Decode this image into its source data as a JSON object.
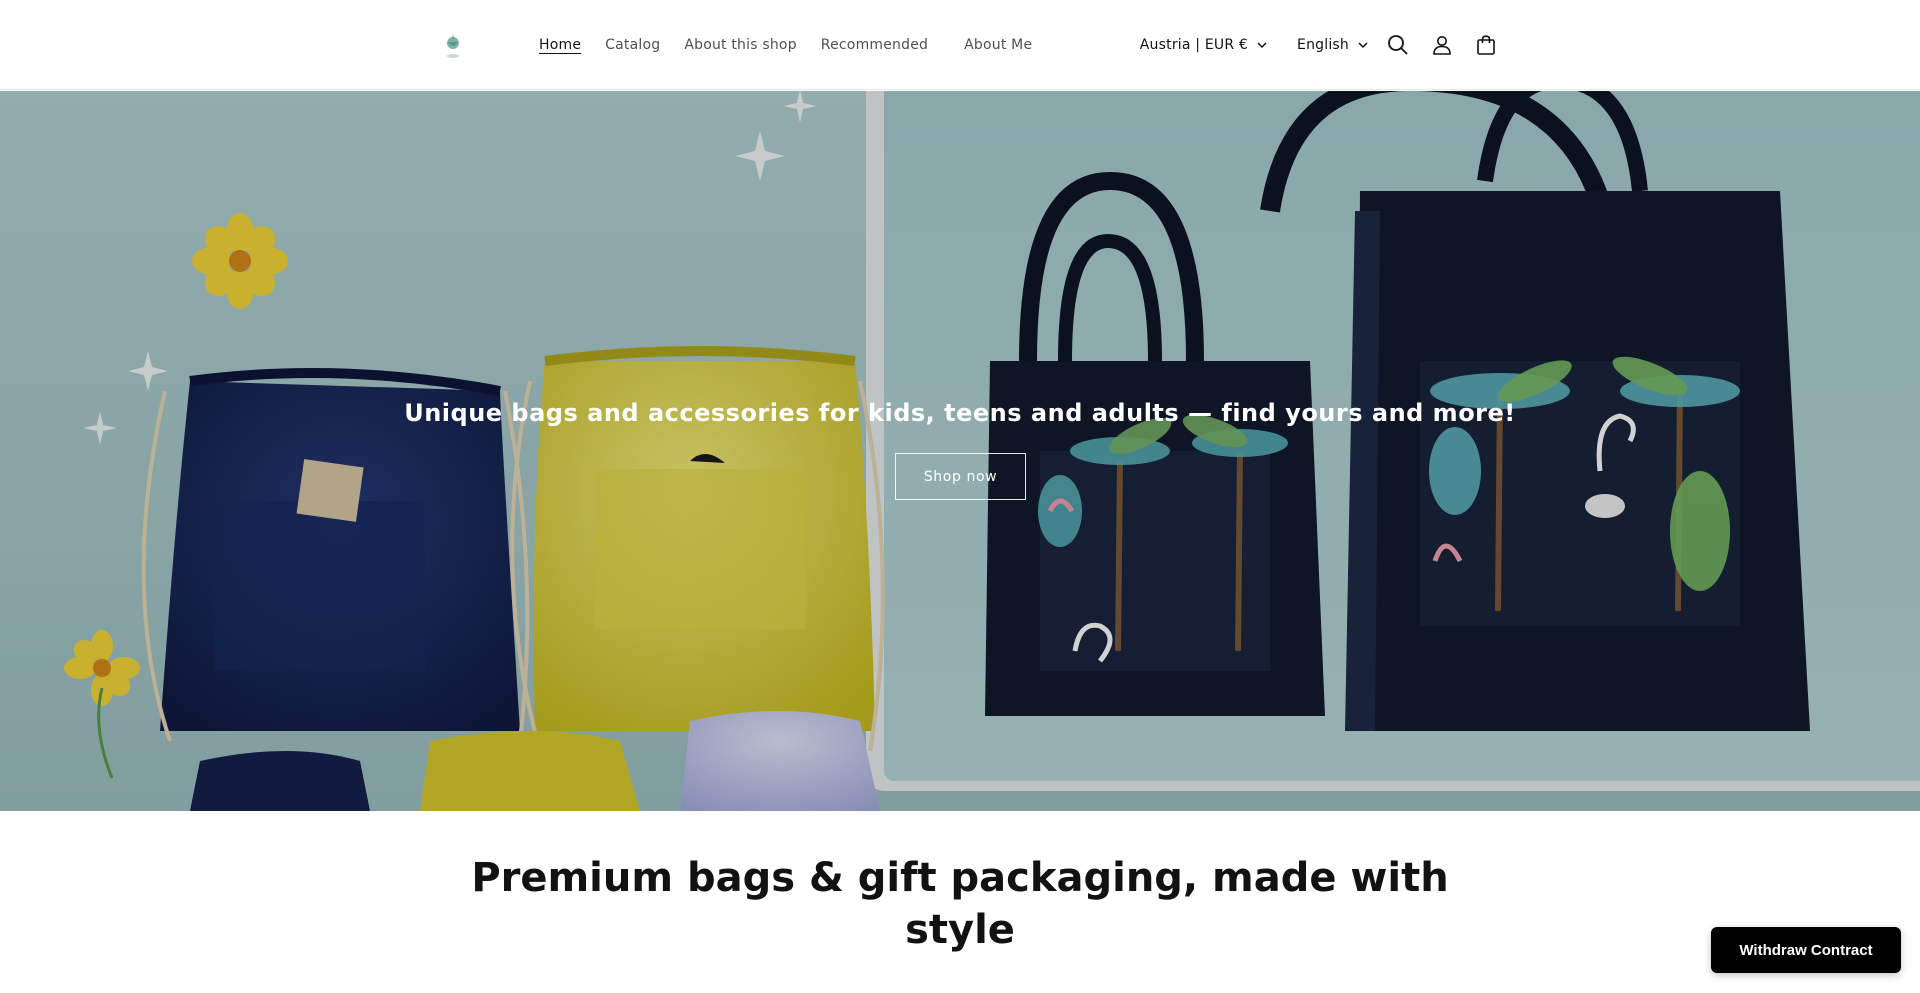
{
  "header": {
    "logo_icon": "shop-logo-icon",
    "nav": [
      {
        "label": "Home",
        "active": true
      },
      {
        "label": "Catalog",
        "active": false
      },
      {
        "label": "About this shop",
        "active": false
      },
      {
        "label": "Recommended",
        "active": false
      },
      {
        "label": "About Me",
        "active": false
      }
    ],
    "country_currency": "Austria | EUR €",
    "language": "English",
    "icons": [
      "search-icon",
      "account-icon",
      "cart-icon"
    ]
  },
  "hero": {
    "tagline": "Unique bags and accessories for kids, teens and adults — find yours and more!",
    "button_label": "Shop now"
  },
  "main": {
    "headline_line1": "Premium bags & gift packaging, made with",
    "headline_line2": "style"
  },
  "floating": {
    "withdraw_label": "Withdraw Contract"
  },
  "colors": {
    "text": "#121212",
    "hero_background": "#a9c9cb",
    "button_dark": "#000000"
  }
}
